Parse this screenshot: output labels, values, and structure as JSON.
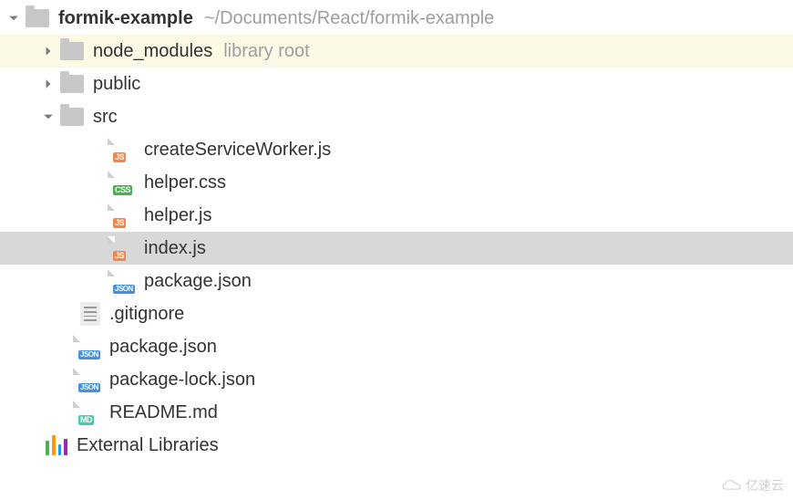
{
  "root": {
    "name": "formik-example",
    "path": "~/Documents/React/formik-example"
  },
  "nodes": {
    "node_modules": {
      "label": "node_modules",
      "hint": "library root"
    },
    "public": {
      "label": "public"
    },
    "src": {
      "label": "src"
    },
    "createServiceWorker": {
      "label": "createServiceWorker.js"
    },
    "helper_css": {
      "label": "helper.css"
    },
    "helper_js": {
      "label": "helper.js"
    },
    "index_js": {
      "label": "index.js"
    },
    "src_package_json": {
      "label": "package.json"
    },
    "gitignore": {
      "label": ".gitignore"
    },
    "package_json": {
      "label": "package.json"
    },
    "package_lock": {
      "label": "package-lock.json"
    },
    "readme": {
      "label": "README.md"
    },
    "external_libs": {
      "label": "External Libraries"
    }
  },
  "badges": {
    "js": "JS",
    "css": "CSS",
    "json": "JSON",
    "md": "MD"
  },
  "watermark": "亿速云"
}
